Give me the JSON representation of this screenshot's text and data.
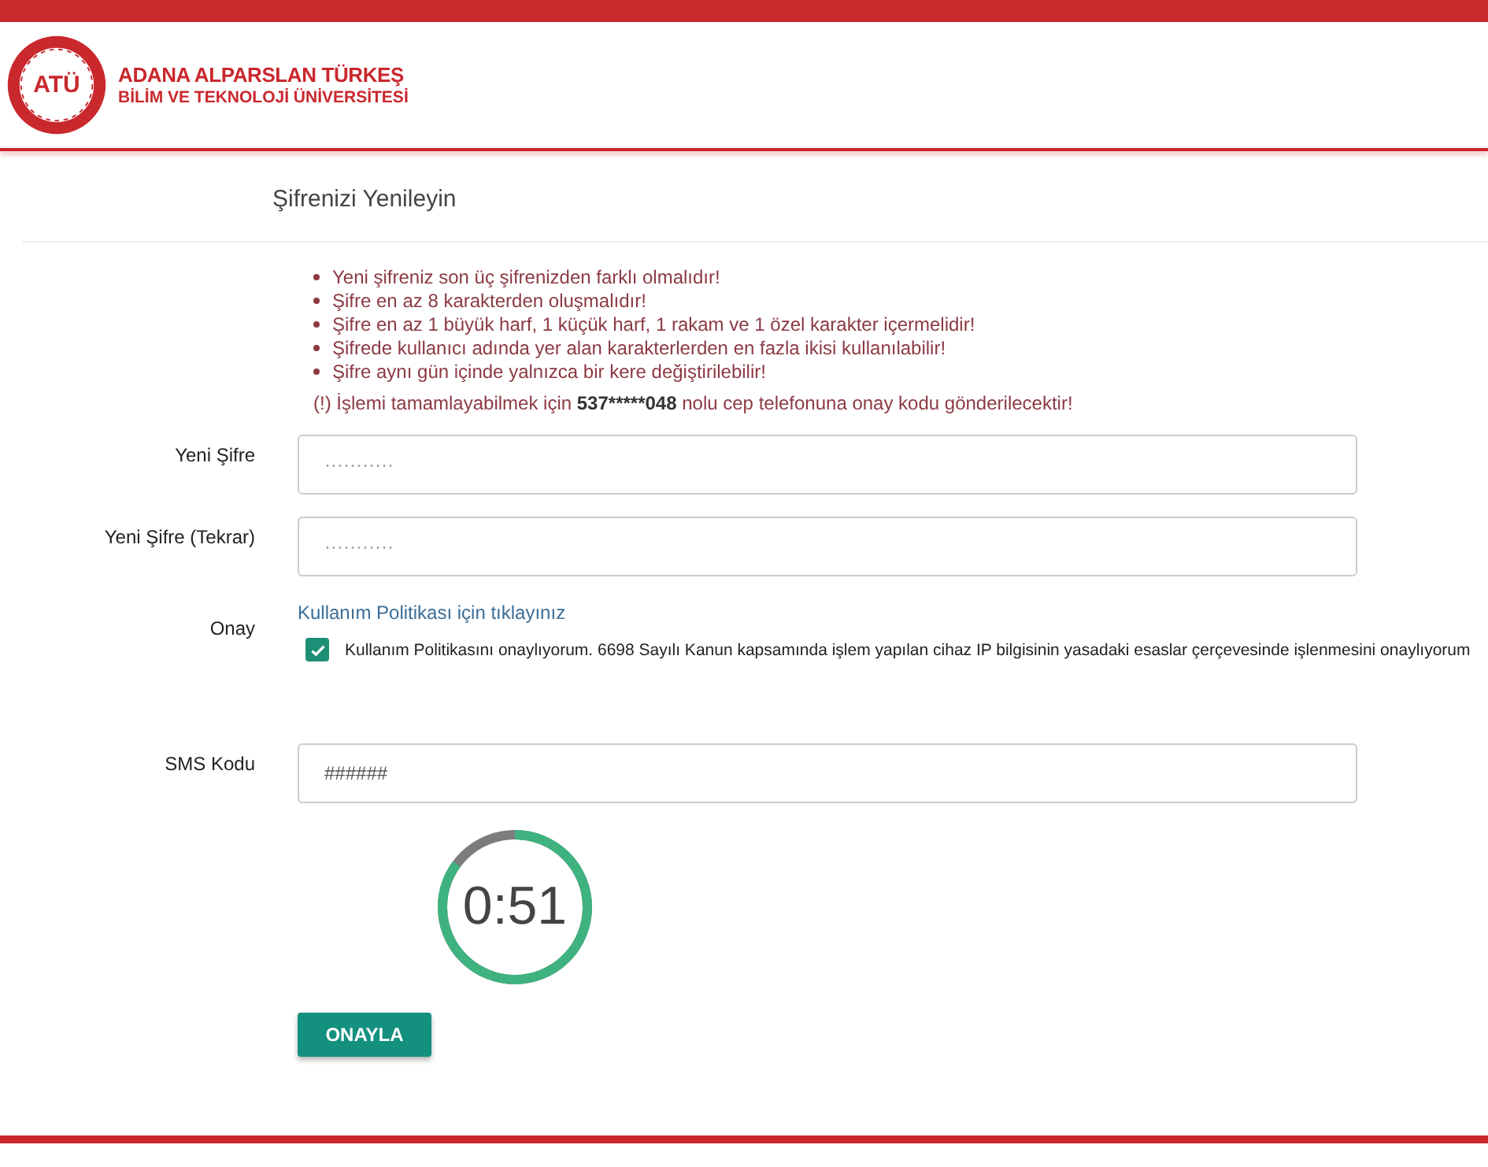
{
  "header": {
    "logo_mark": "ATÜ",
    "logo_line_1": "ADANA ALPARSLAN TÜRKEŞ",
    "logo_line_2": "BİLİM VE TEKNOLOJİ ÜNİVERSİTESİ"
  },
  "title": "Şifrenizi Yenileyin",
  "rules": [
    "Yeni şifreniz son üç şifrenizden farklı olmalıdır!",
    "Şifre en az 8 karakterden oluşmalıdır!",
    "Şifre en az 1 büyük harf, 1 küçük harf, 1 rakam ve 1 özel karakter içermelidir!",
    "Şifrede kullanıcı adında yer alan karakterlerden en fazla ikisi kullanılabilir!",
    "Şifre aynı gün içinde yalnızca bir kere değiştirilebilir!"
  ],
  "notice": {
    "before": "(!) İşlemi tamamlayabilmek için",
    "phone": "537*****048",
    "after": "nolu cep telefonuna onay kodu gönderilecektir!"
  },
  "fields": [
    {
      "label": "Yeni Şifre",
      "placeholder": "···········"
    },
    {
      "label": "Yeni Şifre (Tekrar)",
      "placeholder": "···········"
    }
  ],
  "consent": {
    "label": "Onay",
    "link": "Kullanım Politikası için tıklayınız",
    "checked": true,
    "text": "Kullanım Politikasını onaylıyorum. 6698 Sayılı Kanun kapsamında işlem yapılan cihaz IP bilgisinin yasadaki esaslar çerçevesinde işlenmesini onaylıyorum"
  },
  "sms": {
    "label": "SMS Kodu",
    "placeholder": "######"
  },
  "timer": {
    "reading": "0:51",
    "level": 0.85
  },
  "submit": "ONAYLA"
}
